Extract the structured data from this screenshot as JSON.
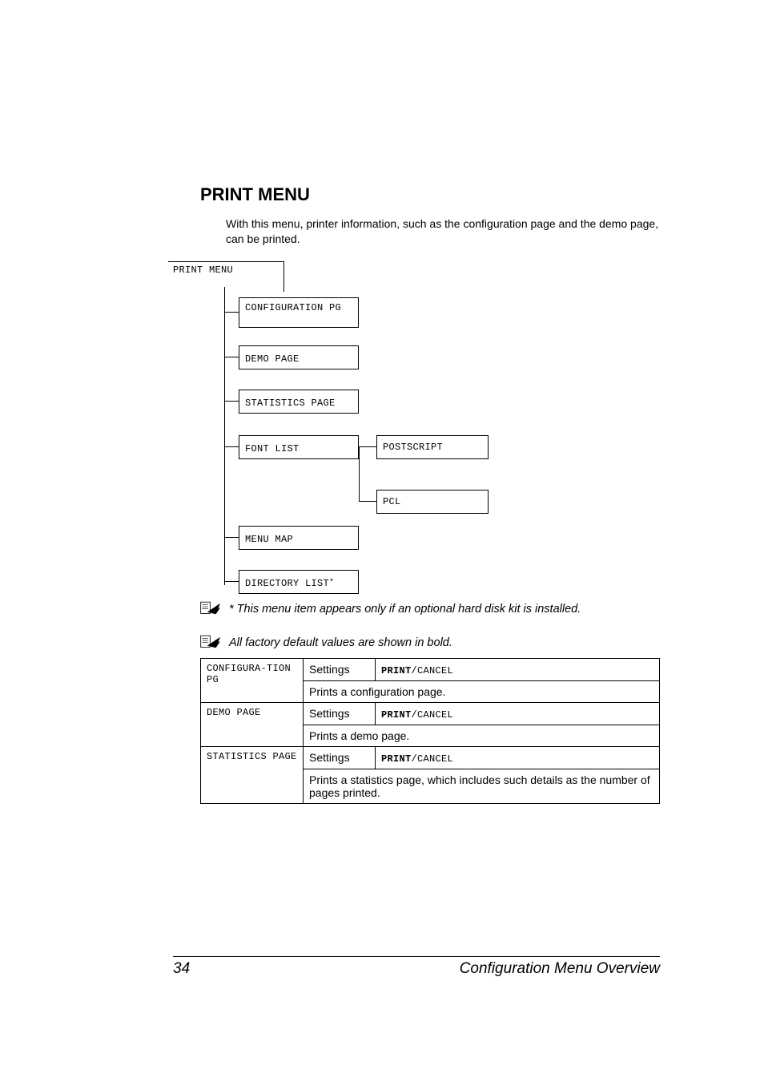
{
  "heading": "PRINT MENU",
  "intro": "With this menu, printer information, such as the configuration page and the demo page, can be printed.",
  "tree": {
    "root": "PRINT MENU",
    "items": [
      "CONFIGURATION PG",
      "DEMO PAGE",
      "STATISTICS PAGE",
      "FONT LIST",
      "MENU MAP",
      "DIRECTORY LIST"
    ],
    "directory_star": "*",
    "fontlist_children": [
      "POSTSCRIPT",
      "PCL"
    ]
  },
  "note1": "* This menu item appears only if an optional hard disk kit is installed.",
  "note2": "All factory default values are shown in bold.",
  "table": {
    "rows": [
      {
        "name": "CONFIGURA-TION PG",
        "settings_label": "Settings",
        "settings_value_bold": "PRINT",
        "settings_value_rest": "/CANCEL",
        "desc": "Prints a configuration page."
      },
      {
        "name": "DEMO PAGE",
        "settings_label": "Settings",
        "settings_value_bold": "PRINT",
        "settings_value_rest": "/CANCEL",
        "desc": "Prints a demo page."
      },
      {
        "name": "STATISTICS PAGE",
        "settings_label": "Settings",
        "settings_value_bold": "PRINT",
        "settings_value_rest": "/CANCEL",
        "desc": "Prints a statistics page, which includes such details as the number of pages printed."
      }
    ]
  },
  "footer": {
    "page": "34",
    "title": "Configuration Menu Overview"
  }
}
